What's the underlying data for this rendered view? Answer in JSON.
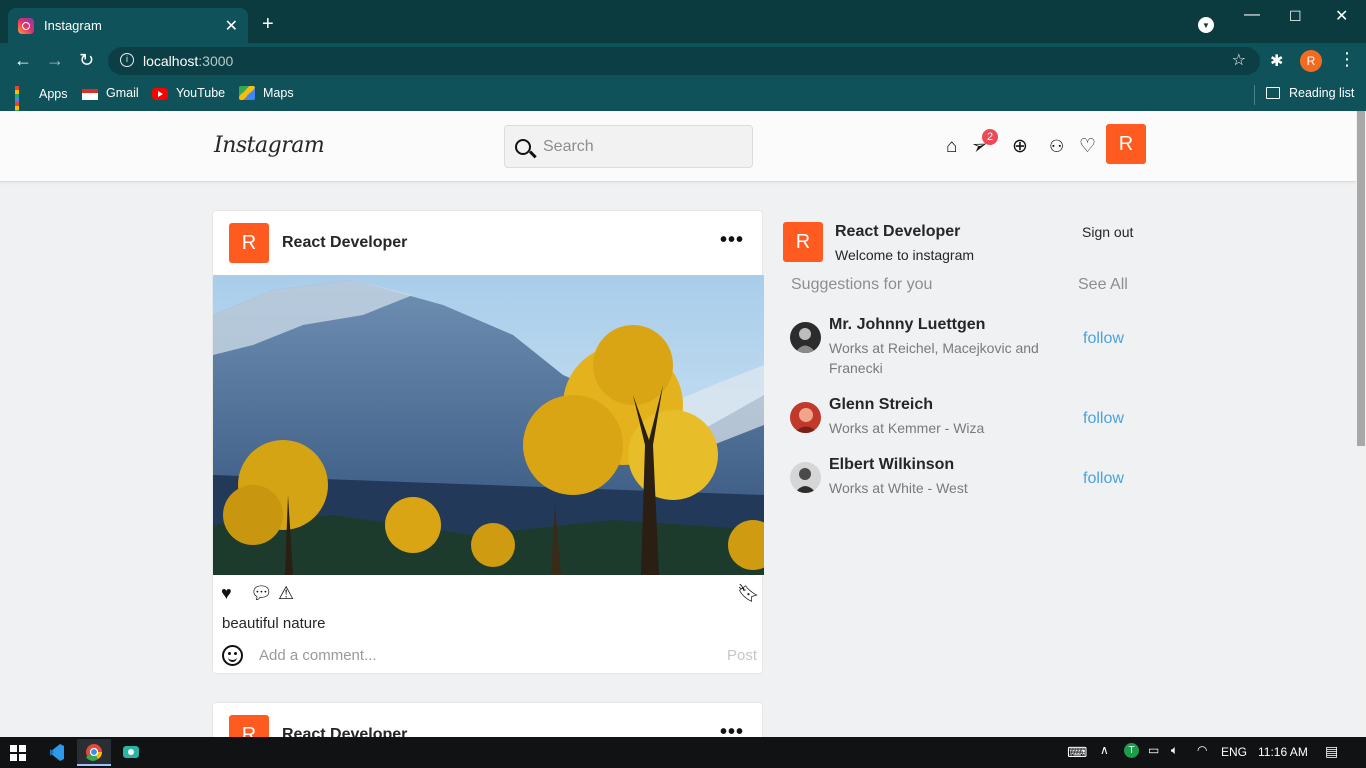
{
  "browser": {
    "tab_title": "Instagram",
    "url_host": "localhost",
    "url_port": ":3000",
    "profile_initial": "R",
    "bookmarks": [
      {
        "label": "Apps",
        "icon": "apps-grid-icon"
      },
      {
        "label": "Gmail",
        "icon": "gmail-icon"
      },
      {
        "label": "YouTube",
        "icon": "youtube-icon"
      },
      {
        "label": "Maps",
        "icon": "maps-icon"
      }
    ],
    "reading_list": "Reading list"
  },
  "header": {
    "logo": "Instagram",
    "search_placeholder": "Search",
    "messages_badge": "2",
    "avatar_initial": "R"
  },
  "post": {
    "avatar_initial": "R",
    "username": "React Developer",
    "more": "•••",
    "caption": "beautiful nature",
    "comment_placeholder": "Add a comment...",
    "post_button": "Post"
  },
  "post2": {
    "avatar_initial": "R",
    "username": "React Developer",
    "more": "•••"
  },
  "sidebar": {
    "avatar_initial": "R",
    "name": "React Developer",
    "subtitle": "Welcome to instagram",
    "sign_out": "Sign out",
    "suggestions_title": "Suggestions for you",
    "see_all": "See All",
    "suggestions": [
      {
        "name": "Mr. Johnny Luettgen",
        "work": "Works at Reichel, Macejkovic and Franecki",
        "action": "follow"
      },
      {
        "name": "Glenn Streich",
        "work": "Works at Kemmer - Wiza",
        "action": "follow"
      },
      {
        "name": "Elbert Wilkinson",
        "work": "Works at White - West",
        "action": "follow"
      }
    ]
  },
  "taskbar": {
    "language": "ENG",
    "time": "11:16 AM"
  },
  "colors": {
    "accent": "#ff5a1f",
    "follow": "#4aa3df",
    "browser_frame": "#0f5259"
  }
}
